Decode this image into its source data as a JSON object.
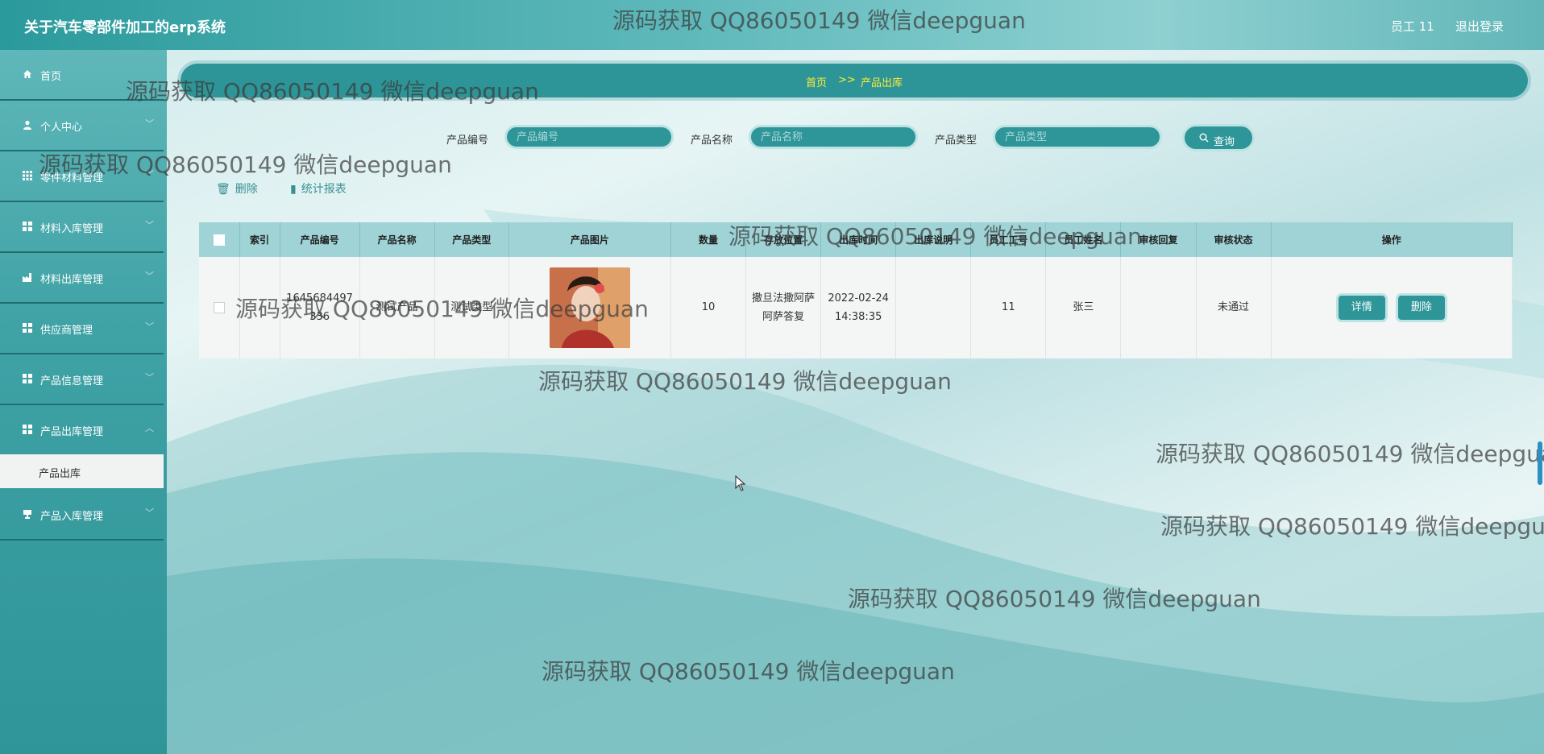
{
  "app_title": "关于汽车零部件加工的erp系统",
  "header": {
    "user_label": "员工 11",
    "logout": "退出登录"
  },
  "sidebar": {
    "items": [
      {
        "label": "首页",
        "icon": "home-icon"
      },
      {
        "label": "个人中心",
        "icon": "user-icon"
      },
      {
        "label": "零件材料管理",
        "icon": "grid-icon"
      },
      {
        "label": "材料入库管理",
        "icon": "grid-icon"
      },
      {
        "label": "材料出库管理",
        "icon": "factory-icon"
      },
      {
        "label": "供应商管理",
        "icon": "grid-icon"
      },
      {
        "label": "产品信息管理",
        "icon": "grid-icon"
      },
      {
        "label": "产品出库管理",
        "icon": "grid-icon"
      },
      {
        "label": "产品入库管理",
        "icon": "cup-icon"
      }
    ],
    "active_sub": "产品出库"
  },
  "breadcrumb": {
    "home": "首页",
    "separator": ">>",
    "current": "产品出库"
  },
  "search": {
    "fields": [
      {
        "label": "产品编号",
        "placeholder": "产品编号"
      },
      {
        "label": "产品名称",
        "placeholder": "产品名称"
      },
      {
        "label": "产品类型",
        "placeholder": "产品类型"
      }
    ],
    "button": "查询"
  },
  "actions": {
    "delete": "删除",
    "report": "统计报表"
  },
  "table": {
    "columns": [
      "",
      "索引",
      "产品编号",
      "产品名称",
      "产品类型",
      "产品图片",
      "数量",
      "存放位置",
      "出库时间",
      "出库说明",
      "员工工号",
      "员工姓名",
      "审核回复",
      "审核状态",
      "操作"
    ],
    "rows": [
      {
        "index": "",
        "product_no": "1645684497336",
        "product_name": "测试产品",
        "product_type": "测试类型",
        "quantity": "10",
        "location": "撒旦法撒阿萨阿萨答复",
        "out_time": "2022-02-24 14:38:35",
        "note": "",
        "staff_no": "11",
        "staff_name": "张三",
        "review_reply": "",
        "review_status": "未通过",
        "detail_btn": "详情",
        "delete_btn": "删除"
      }
    ]
  },
  "watermark": "源码获取 QQ86050149 微信deepguan",
  "colors": {
    "primary": "#2e9598",
    "header_start": "#2b9a9c",
    "breadcrumb_text": "#ffeb3b",
    "table_header": "#9fd3d6"
  }
}
